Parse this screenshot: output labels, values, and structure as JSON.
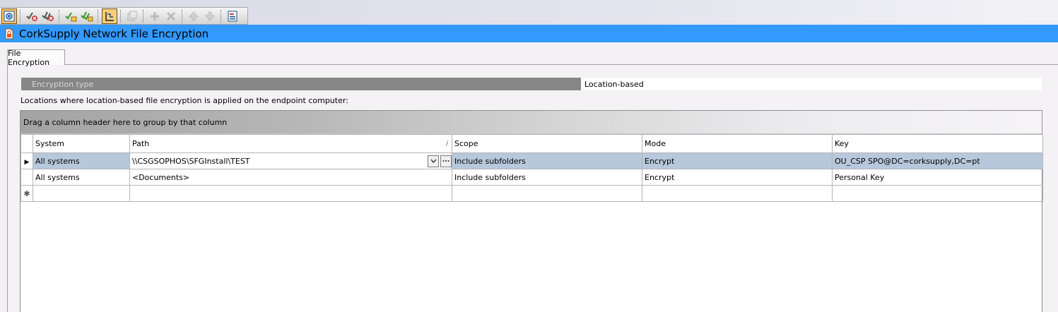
{
  "toolbar": {
    "buttons": [
      {
        "icon": "policy-view-icon",
        "state": "active"
      },
      {
        "icon": "check-cancel-icon",
        "state": "normal"
      },
      {
        "icon": "check-cancel-all-icon",
        "state": "normal"
      },
      {
        "icon": "check-ok-icon",
        "state": "normal"
      },
      {
        "icon": "check-ok-all-icon",
        "state": "normal"
      },
      {
        "icon": "properties-icon",
        "state": "selected"
      },
      {
        "icon": "copy-icon",
        "state": "disabled"
      },
      {
        "icon": "add-icon",
        "state": "disabled"
      },
      {
        "icon": "delete-icon",
        "state": "disabled"
      },
      {
        "icon": "move-up-icon",
        "state": "disabled"
      },
      {
        "icon": "move-down-icon",
        "state": "disabled"
      },
      {
        "icon": "report-icon",
        "state": "normal"
      }
    ]
  },
  "window": {
    "title": "CorkSupply Network File Encryption",
    "title_color": "#3399ff"
  },
  "tabs": [
    {
      "label": "File Encryption",
      "active": true
    }
  ],
  "encryption": {
    "type_label": "Encryption type",
    "type_value": "Location-based"
  },
  "locations_label": "Locations where location-based file encryption is applied on the endpoint computer:",
  "grid": {
    "group_hint": "Drag a column header here to group by that column",
    "columns": [
      "System",
      "Path",
      "Scope",
      "Mode",
      "Key"
    ],
    "sorted_column": "Path",
    "rows": [
      {
        "system": "All systems",
        "path": "\\\\CSGSOPHOS\\SFGInstall\\TEST",
        "scope": "Include subfolders",
        "mode": "Encrypt",
        "key": "OU_CSP SPO@DC=corksupply,DC=pt",
        "current": true
      },
      {
        "system": "All systems",
        "path": "<Documents>",
        "scope": "Include subfolders",
        "mode": "Encrypt",
        "key": "Personal Key",
        "current": false
      }
    ],
    "selection_color": "#b7c8dc"
  }
}
